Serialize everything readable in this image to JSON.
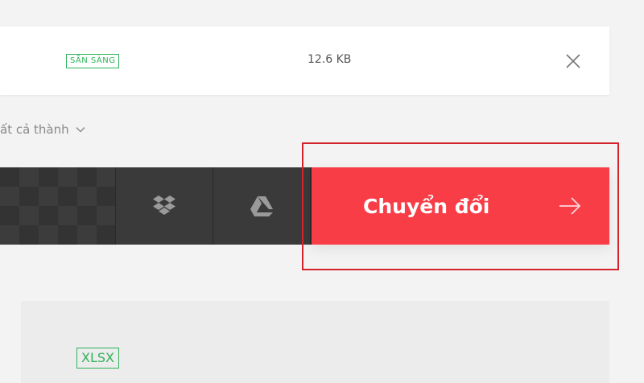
{
  "file": {
    "status": "SẴN SÀNG",
    "size": "12.6 KB"
  },
  "convert_all": {
    "label": "ất cả thành"
  },
  "toolbar": {
    "convert_label": "Chuyển đổi"
  },
  "lower_file": {
    "format": "XLSX"
  },
  "icons": [
    "close-icon",
    "chevron-down-icon",
    "dropbox-icon",
    "google-drive-icon",
    "arrow-right-icon"
  ],
  "colors": {
    "accent": "#f83d46",
    "status_green": "#2fb35a",
    "toolbar_dark": "#3a3a3a",
    "highlight": "#d4232b"
  }
}
